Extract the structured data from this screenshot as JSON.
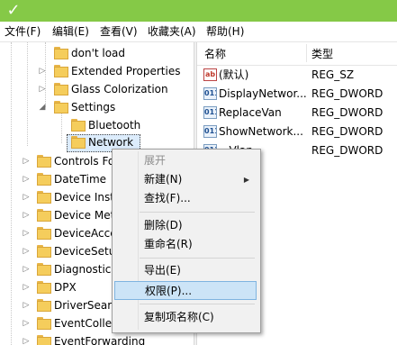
{
  "menubar": {
    "file": "文件(F)",
    "edit": "编辑(E)",
    "view": "查看(V)",
    "favorites": "收藏夹(A)",
    "help": "帮助(H)"
  },
  "tree": {
    "items": [
      "don't load",
      "Extended Properties",
      "Glass Colorization",
      "Settings",
      "Bluetooth",
      "Network",
      "Controls Fo",
      "DateTime",
      "Device Insta",
      "Device Met",
      "DeviceAcce",
      "DeviceSetup",
      "Diagnostics",
      "DPX",
      "DriverSearc",
      "EventCollec",
      "EventForwarding"
    ]
  },
  "listview": {
    "col_name": "名称",
    "col_type": "类型",
    "rows": [
      {
        "name": "(默认)",
        "type": "REG_SZ",
        "icon": "ab"
      },
      {
        "name": "DisplayNetwor...",
        "type": "REG_DWORD",
        "icon": "011"
      },
      {
        "name": "ReplaceVan",
        "type": "REG_DWORD",
        "icon": "011"
      },
      {
        "name": "ShowNetwork...",
        "type": "REG_DWORD",
        "icon": "011"
      },
      {
        "name": "...Vlan",
        "type": "REG_DWORD",
        "icon": "011"
      }
    ]
  },
  "context_menu": {
    "expand": "展开",
    "new": "新建(N)",
    "find": "查找(F)...",
    "delete": "删除(D)",
    "rename": "重命名(R)",
    "export": "导出(E)",
    "permissions": "权限(P)...",
    "copy_key_name": "复制项名称(C)"
  },
  "colors": {
    "titlebar": "#85c947",
    "highlight": "#cce4f7"
  }
}
